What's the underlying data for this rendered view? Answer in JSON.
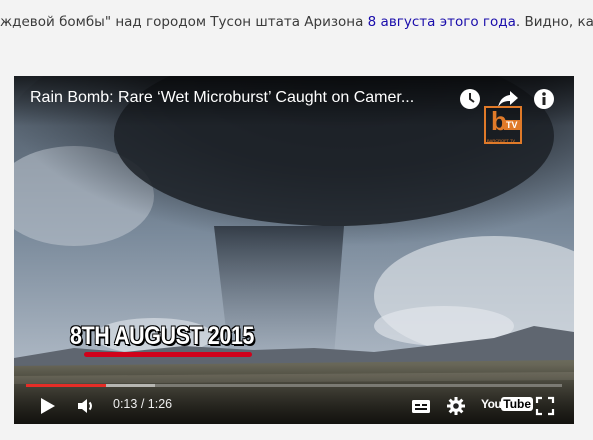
{
  "article": {
    "text_before": "ждевой бомбы\" над городом Тусон штата Аризона ",
    "highlight": "8 августа этого года",
    "text_after": ". Видно, как из"
  },
  "video": {
    "title": "Rain Bomb: Rare ‘Wet Microburst’ Caught on Camer...",
    "caption": "8TH AUGUST 2015",
    "channel_logo": {
      "letter": "b",
      "badge": "TV",
      "name": "BARCROFT TV"
    },
    "current_time": "0:13",
    "duration": "1:26",
    "time_separator": " / ",
    "progress_played": 0.15,
    "progress_loaded": 0.24,
    "youtube_logo": {
      "you": "You",
      "tube": "Tube"
    }
  },
  "colors": {
    "highlight_underline": "#d0021b",
    "progress_played": "#e52d27",
    "brand_orange": "#e07a29"
  },
  "icons": {
    "watch_later": "clock-icon",
    "share": "share-arrow-icon",
    "info": "info-icon",
    "play": "play-icon",
    "volume": "volume-icon",
    "subtitles": "subtitles-icon",
    "settings": "gear-icon",
    "fullscreen": "fullscreen-icon"
  }
}
